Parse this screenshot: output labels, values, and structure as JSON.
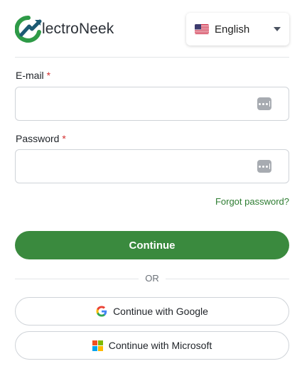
{
  "header": {
    "logo_text": "lectroNeek",
    "language": {
      "selected": "English",
      "flag": "us-flag-icon"
    }
  },
  "form": {
    "email": {
      "label": "E-mail",
      "required_mark": "*",
      "value": "",
      "placeholder": ""
    },
    "password": {
      "label": "Password",
      "required_mark": "*",
      "value": "",
      "placeholder": ""
    },
    "forgot_label": "Forgot password?",
    "continue_label": "Continue",
    "or_label": "OR",
    "google_label": "Continue with Google",
    "microsoft_label": "Continue with Microsoft"
  },
  "colors": {
    "brand_green": "#3a8a3e",
    "link_green": "#2e7d32",
    "required_red": "#d32f2f"
  }
}
